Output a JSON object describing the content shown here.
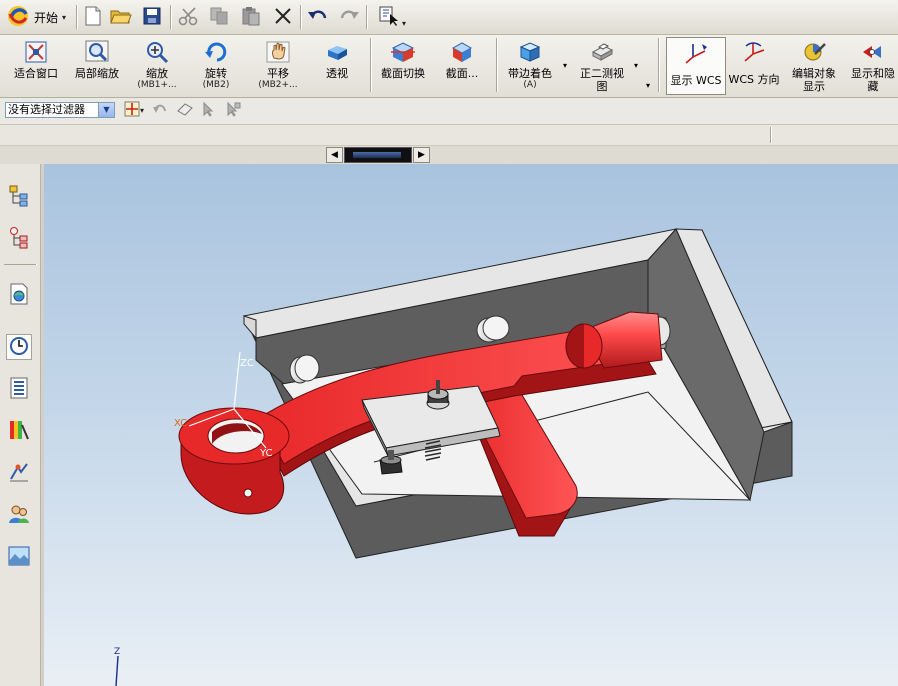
{
  "menubar": {
    "start_label": "开始",
    "icons": [
      "new-file-icon",
      "open-folder-icon",
      "save-icon",
      "cut-icon",
      "copy-icon",
      "paste-icon",
      "delete-icon",
      "undo-icon",
      "redo-icon",
      "selection-icon"
    ]
  },
  "ribbon": {
    "fit": "适合窗口",
    "zoom_region": "局部缩放",
    "zoom": "缩放",
    "zoom_hint": "(MB1+...",
    "rotate": "旋转",
    "rotate_hint": "(MB2)",
    "pan": "平移",
    "pan_hint": "(MB2+...",
    "perspective": "透视",
    "section_toggle": "截面切换",
    "section": "截面...",
    "shaded_edges": "带边着色",
    "shaded_edges_hint": "(A)",
    "trimetric": "正二测视",
    "trimetric_2": "图",
    "show_wcs": "显示 WCS",
    "wcs_orient": "WCS 方向",
    "edit_display": "编辑对象",
    "edit_display_2": "显示",
    "show_hide": "显示和隐",
    "show_hide_2": "藏"
  },
  "filterbar": {
    "filter_value": "没有选择过滤器"
  },
  "viewport": {
    "wcs_x": "XC",
    "wcs_y": "YC",
    "wcs_z": "ZC",
    "abs_z": "Z"
  },
  "colors": {
    "part_red": "#e8292a",
    "part_red_dark": "#a31417",
    "base_gray": "#d9d9d9",
    "base_gray_dark": "#5e5e5e",
    "wcs_orange": "#d8651a"
  }
}
